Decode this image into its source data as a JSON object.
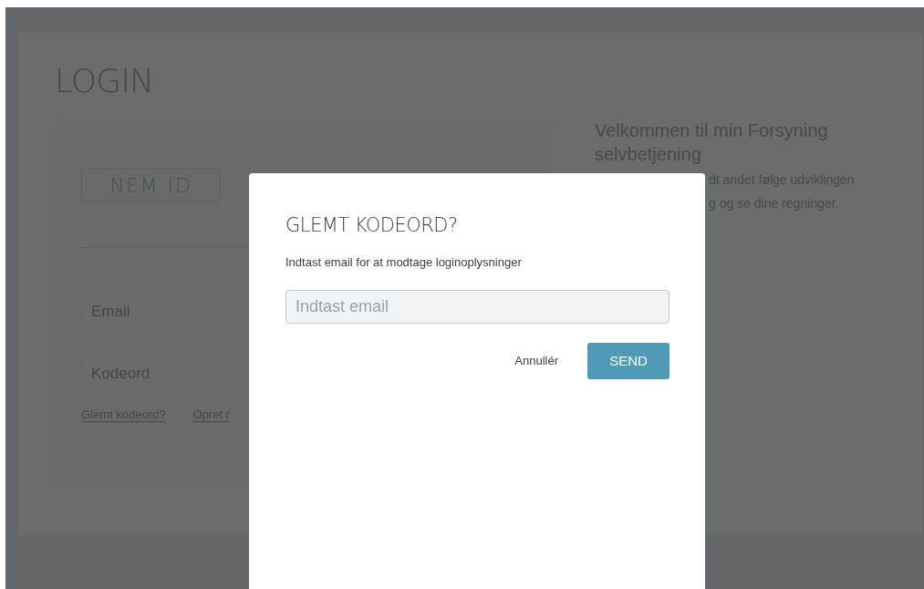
{
  "login": {
    "title": "LOGIN",
    "nemid_button": "NƐM ID",
    "fields": [
      {
        "placeholder": "Email"
      },
      {
        "placeholder": "Kodeord"
      }
    ],
    "links": [
      "Glemt kodeord?",
      "Opret r"
    ]
  },
  "welcome": {
    "heading": "Velkommen til min Forsyning selvbetjening",
    "body_lines": [
      "dt andet følge udviklingen",
      "g og se dine regninger."
    ]
  },
  "dialog": {
    "title": "GLEMT KODEORD?",
    "text": "Indtast email for at modtage loginoplysninger",
    "email_field": {
      "placeholder": "Indtast email"
    },
    "buttons": [
      {
        "label": "Annullér",
        "kind": "link"
      },
      {
        "label": "SEND",
        "kind": "primary"
      }
    ]
  }
}
